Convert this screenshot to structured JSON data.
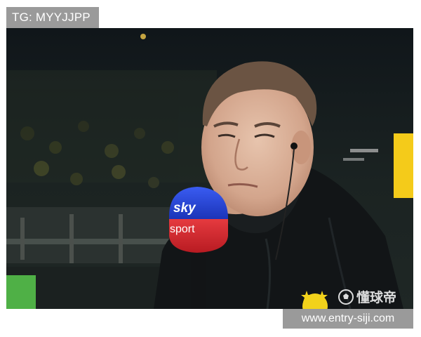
{
  "overlay": {
    "tg_label": "TG: MYYJJPP",
    "watermark_text": "懂球帝",
    "url_label": "www.entry-siji.com"
  },
  "microphone": {
    "brand_line1": "sky",
    "brand_line2": "sport"
  },
  "colors": {
    "tag_bg": "#9a9a9a",
    "mic_blue": "#1e3fd8",
    "mic_red": "#d8232a",
    "jacket": "#111416",
    "crest_yellow": "#f2d21b"
  }
}
